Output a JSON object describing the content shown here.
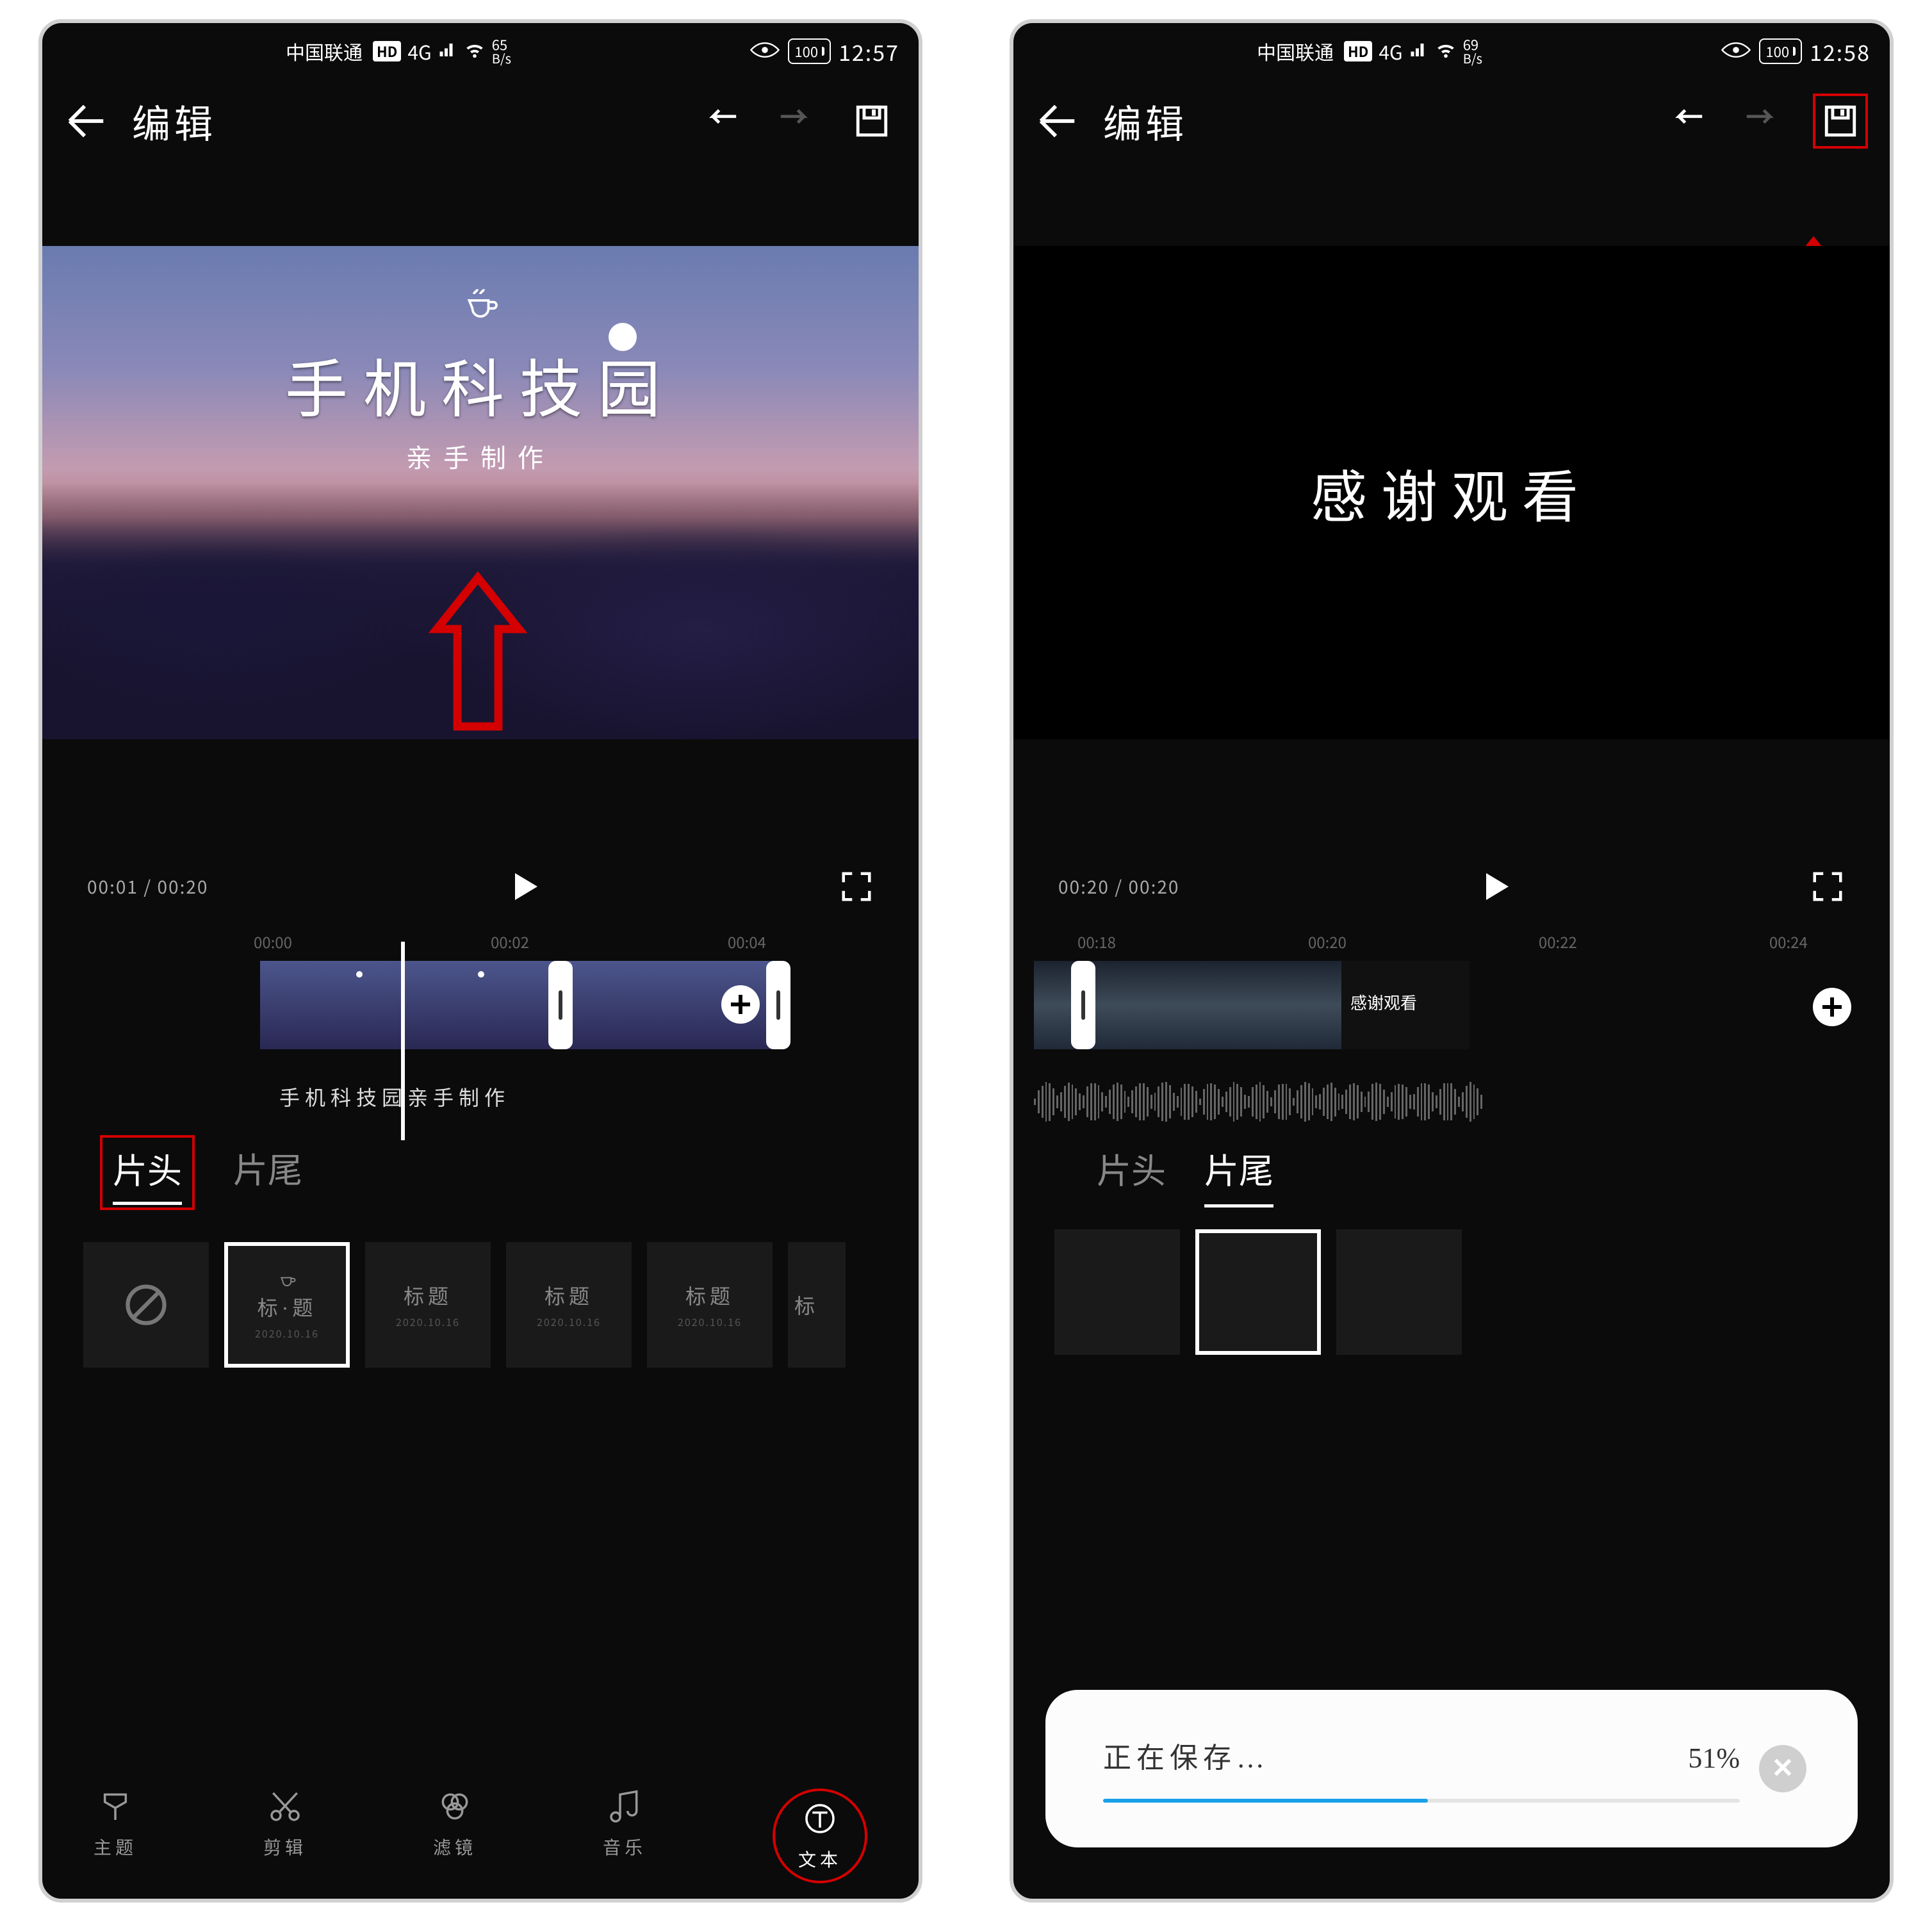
{
  "colors": {
    "annotation": "#d40000",
    "progress": "#18a0ea"
  },
  "left": {
    "status": {
      "carrier": "中国联通",
      "hd": "HD",
      "net": "4G",
      "speed_value": "65",
      "speed_unit": "B/s",
      "battery": "100",
      "time": "12:57"
    },
    "title": "编辑",
    "preview": {
      "title": "手机科技园",
      "subtitle": "亲手制作"
    },
    "playback": {
      "current": "00:01",
      "total": "00:20",
      "ruler": [
        "00:00",
        "00:02",
        "00:04"
      ]
    },
    "timeline_caption": "手机科技园亲手制作",
    "tabs": {
      "head": "片头",
      "tail": "片尾",
      "active": "head"
    },
    "templates": {
      "selected": {
        "title": "标·题",
        "date": "2020.10.16"
      },
      "items": [
        {
          "title": "标题",
          "date": "2020.10.16"
        },
        {
          "title": "标题",
          "date": "2020.10.16"
        },
        {
          "title": "标题",
          "date": "2020.10.16"
        },
        {
          "title": "标",
          "date": ""
        }
      ]
    },
    "nav": {
      "theme": "主题",
      "cut": "剪辑",
      "filter": "滤镜",
      "music": "音乐",
      "text": "文本"
    }
  },
  "right": {
    "status": {
      "carrier": "中国联通",
      "hd": "HD",
      "net": "4G",
      "speed_value": "69",
      "speed_unit": "B/s",
      "battery": "100",
      "time": "12:58"
    },
    "title": "编辑",
    "preview": {
      "title": "感谢观看"
    },
    "playback": {
      "current": "00:20",
      "total": "00:20",
      "ruler": [
        "00:18",
        "00:20",
        "00:22",
        "00:24"
      ]
    },
    "timeline_thumb_text": "感谢观看",
    "tabs": {
      "head": "片头",
      "tail": "片尾",
      "active": "tail"
    },
    "saving": {
      "label": "正在保存…",
      "percent_text": "51%",
      "percent_value": 51
    }
  }
}
